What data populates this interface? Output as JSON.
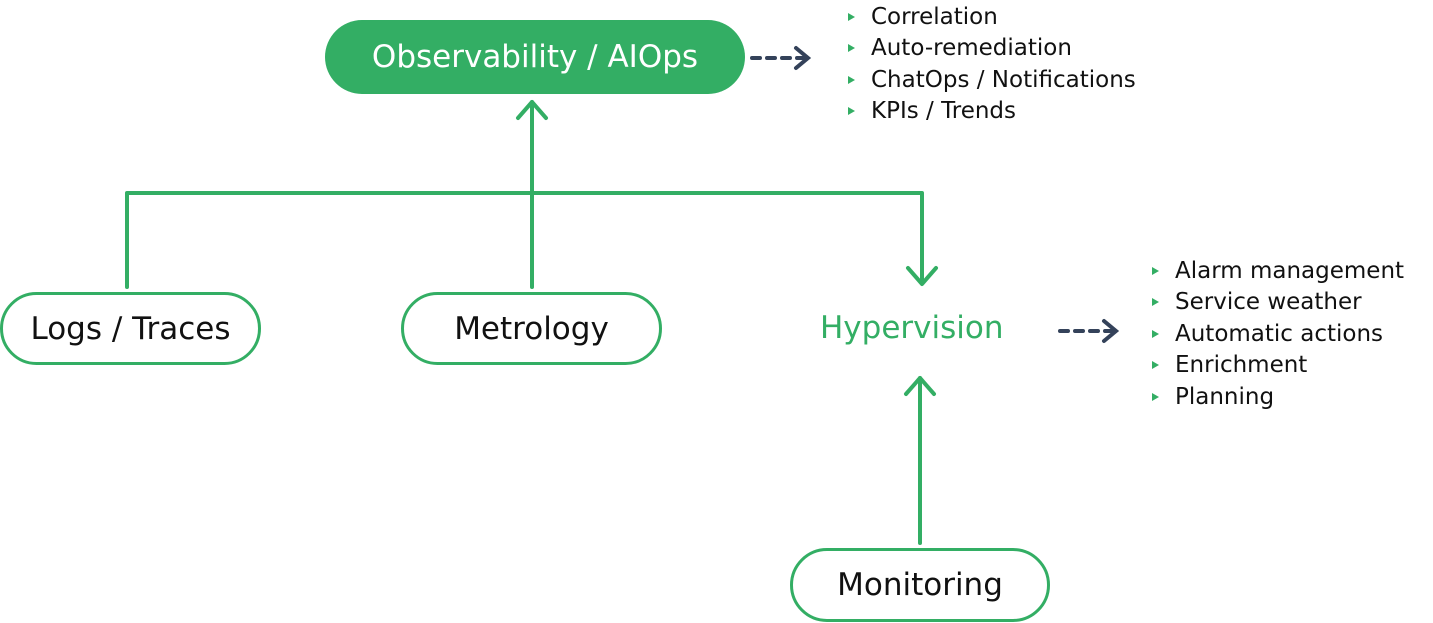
{
  "nodes": {
    "observability": "Observability / AIOps",
    "logs": "Logs / Traces",
    "metrology": "Metrology",
    "hypervision": "Hypervision",
    "monitoring": "Monitoring"
  },
  "observability_features": [
    "Correlation",
    "Auto-remediation",
    "ChatOps / Notifications",
    "KPIs / Trends"
  ],
  "hypervision_features": [
    "Alarm management",
    "Service weather",
    "Automatic actions",
    "Enrichment",
    "Planning"
  ],
  "colors": {
    "accent": "#33ae64",
    "dashed_arrow": "#34425a",
    "text": "#111111"
  }
}
